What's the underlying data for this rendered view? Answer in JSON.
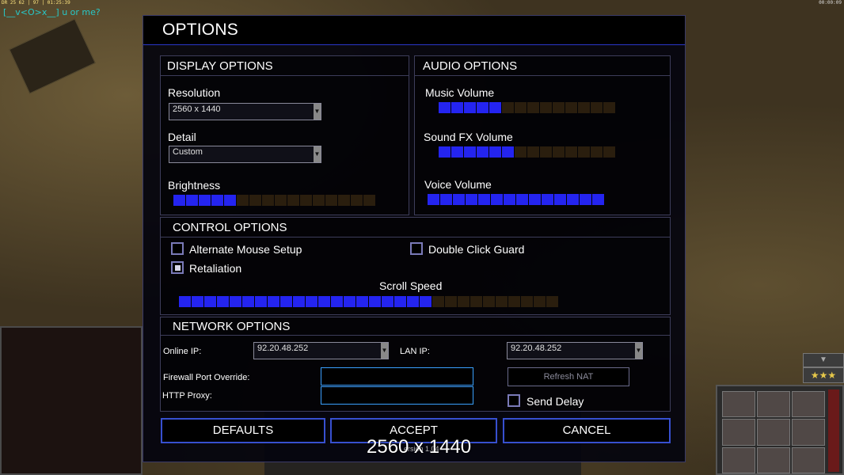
{
  "hud": {
    "left_text": "DR 25 62 | 97 | 01:25:39",
    "right_text": "00:00:09",
    "chat": "[__v<O>x__] u or me?"
  },
  "colors": {
    "accent": "#3750d0",
    "slider_on": "#2424f0",
    "slider_off": "#2a1e0e",
    "input_border": "#3aa0ff"
  },
  "dialog": {
    "title": "OPTIONS"
  },
  "display": {
    "title": "DISPLAY OPTIONS",
    "resolution_label": "Resolution",
    "resolution_value": "2560 x 1440",
    "detail_label": "Detail",
    "detail_value": "Custom",
    "brightness_label": "Brightness",
    "brightness": {
      "filled": 5,
      "total": 16
    }
  },
  "audio": {
    "title": "AUDIO OPTIONS",
    "music_label": "Music Volume",
    "music": {
      "filled": 5,
      "total": 14
    },
    "sfx_label": "Sound FX Volume",
    "sfx": {
      "filled": 6,
      "total": 14
    },
    "voice_label": "Voice Volume",
    "voice": {
      "filled": 14,
      "total": 14
    }
  },
  "control": {
    "title": "CONTROL OPTIONS",
    "alt_mouse_label": "Alternate Mouse Setup",
    "alt_mouse_checked": false,
    "double_click_label": "Double Click Guard",
    "double_click_checked": false,
    "retaliation_label": "Retaliation",
    "retaliation_checked": true,
    "scroll_label": "Scroll Speed",
    "scroll": {
      "filled": 20,
      "total": 30
    }
  },
  "network": {
    "title": "NETWORK OPTIONS",
    "online_ip_label": "Online IP:",
    "online_ip_value": "92.20.48.252",
    "lan_ip_label": "LAN IP:",
    "lan_ip_value": "92.20.48.252",
    "firewall_label": "Firewall Port Override:",
    "firewall_value": "",
    "proxy_label": "HTTP Proxy:",
    "proxy_value": "",
    "refresh_nat_label": "Refresh NAT",
    "send_delay_label": "Send Delay",
    "send_delay_checked": false
  },
  "buttons": {
    "defaults": "DEFAULTS",
    "accept": "ACCEPT",
    "cancel": "CANCEL"
  },
  "overlay": {
    "resolution_caption": "2560 x 1440",
    "version_partial": "ersion 1.04"
  },
  "side_ui": {
    "arrow_glyph": "▼",
    "stars_glyph": "★★★"
  }
}
